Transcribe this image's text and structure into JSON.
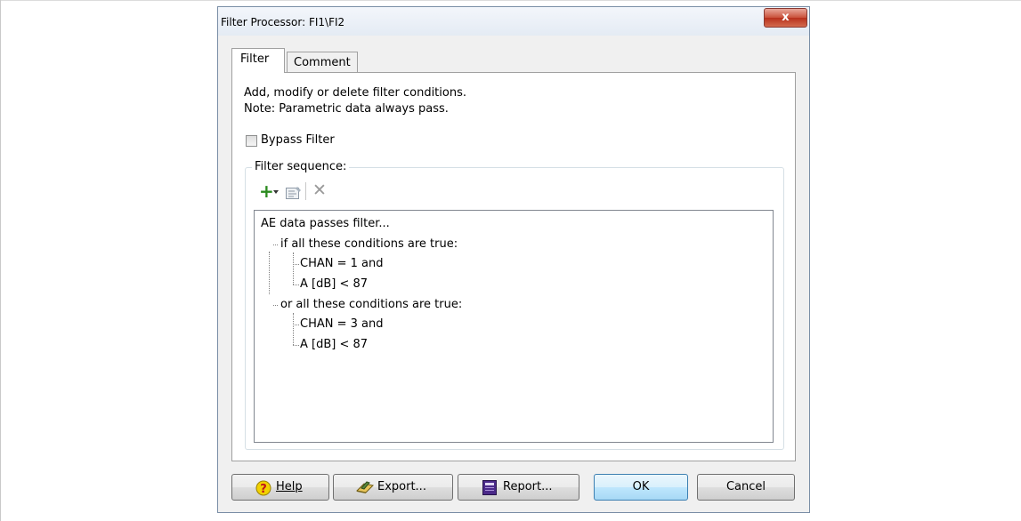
{
  "dialog": {
    "title": "Filter Processor: FI1\\FI2",
    "close_label": "x"
  },
  "tabs": [
    {
      "label": "Filter"
    },
    {
      "label": "Comment"
    }
  ],
  "filter_tab": {
    "description_line1": "Add, modify or delete filter conditions.",
    "description_line2": "Note: Parametric data always pass.",
    "bypass_checkbox": {
      "label": "Bypass Filter",
      "checked": false
    },
    "sequence_legend": "Filter sequence:",
    "toolbar": {
      "add_symbol": "+",
      "delete_symbol": "✕",
      "icons": [
        "add-condition-icon",
        "dropdown-arrow-icon",
        "properties-icon",
        "delete-icon"
      ]
    },
    "tree": {
      "root": "AE data passes filter...",
      "groups": [
        {
          "label": "if all these conditions are true:",
          "conditions": [
            "CHAN = 1 and",
            "A [dB] < 87"
          ]
        },
        {
          "label": "or all these conditions are true:",
          "conditions": [
            "CHAN = 3 and",
            "A [dB] < 87"
          ]
        }
      ]
    }
  },
  "buttons": {
    "help": "Help",
    "export": "Export...",
    "report": "Report...",
    "ok": "OK",
    "cancel": "Cancel"
  },
  "colors": {
    "add_icon": "#2a8a1e",
    "ok_button": "#bee6fd",
    "close_button": "#c9503a",
    "help_icon": "#f2d200"
  }
}
